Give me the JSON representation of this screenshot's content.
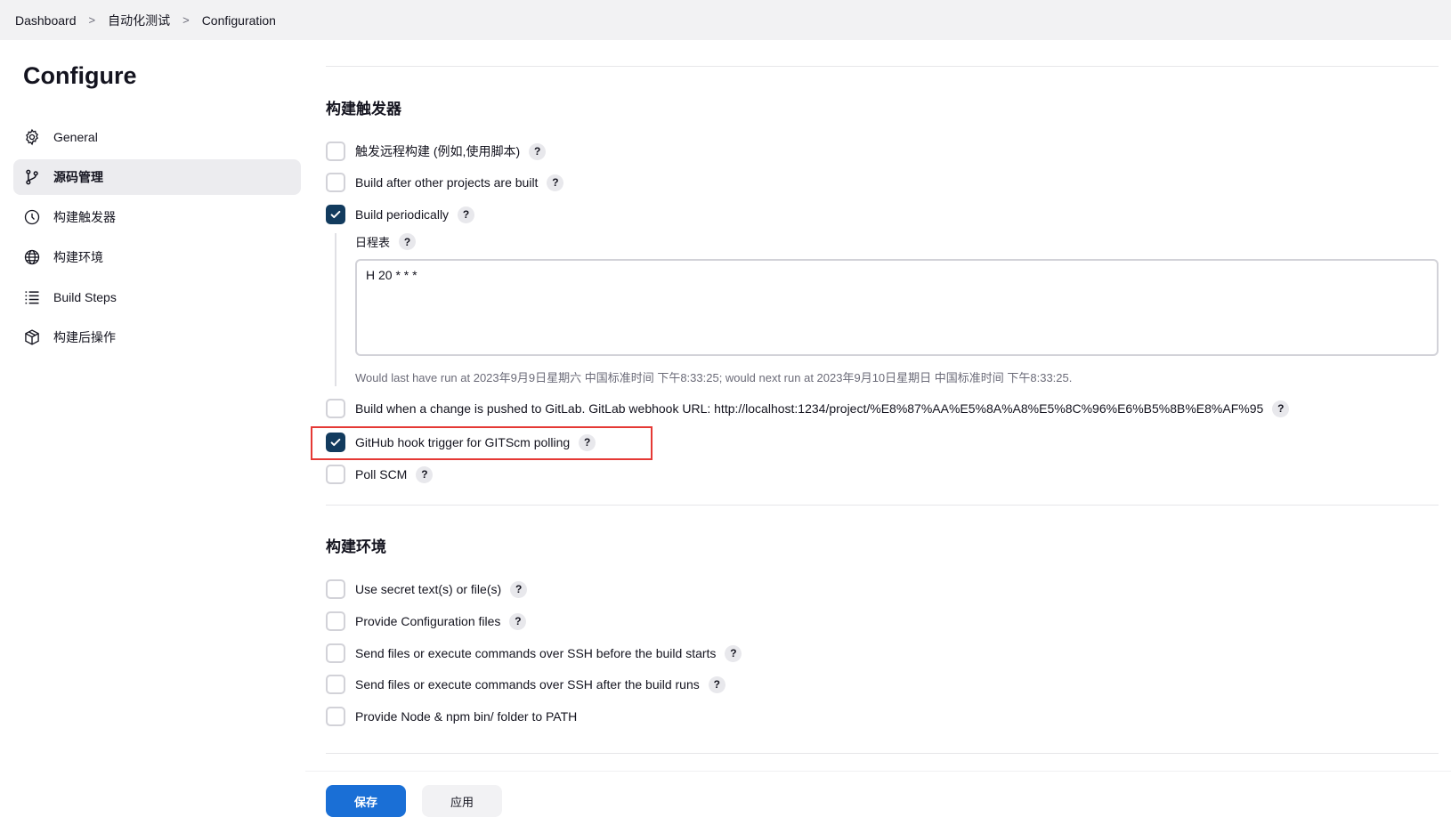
{
  "breadcrumb": [
    "Dashboard",
    "自动化测试",
    "Configuration"
  ],
  "page_title": "Configure",
  "sidebar": {
    "items": [
      {
        "label": "General",
        "icon": "gear-icon"
      },
      {
        "label": "源码管理",
        "icon": "branch-icon"
      },
      {
        "label": "构建触发器",
        "icon": "clock-icon"
      },
      {
        "label": "构建环境",
        "icon": "globe-icon"
      },
      {
        "label": "Build Steps",
        "icon": "list-icon"
      },
      {
        "label": "构建后操作",
        "icon": "package-icon"
      }
    ],
    "active_index": 1
  },
  "triggers": {
    "title": "构建触发器",
    "options": [
      {
        "label": "触发远程构建 (例如,使用脚本)",
        "checked": false
      },
      {
        "label": "Build after other projects are built",
        "checked": false
      },
      {
        "label": "Build periodically",
        "checked": true
      },
      {
        "label": "Build when a change is pushed to GitLab. GitLab webhook URL: http://localhost:1234/project/%E8%87%AA%E5%8A%A8%E5%8C%96%E6%B5%8B%E8%AF%95",
        "checked": false
      },
      {
        "label": "GitHub hook trigger for GITScm polling",
        "checked": true
      },
      {
        "label": "Poll SCM",
        "checked": false
      }
    ],
    "schedule": {
      "label": "日程表",
      "value": "H 20 * * *",
      "info": "Would last have run at 2023年9月9日星期六 中国标准时间 下午8:33:25; would next run at 2023年9月10日星期日 中国标准时间 下午8:33:25."
    }
  },
  "environment": {
    "title": "构建环境",
    "options": [
      {
        "label": "Use secret text(s) or file(s)",
        "checked": false,
        "help": true
      },
      {
        "label": "Provide Configuration files",
        "checked": false,
        "help": true
      },
      {
        "label": "Send files or execute commands over SSH before the build starts",
        "checked": false,
        "help": true
      },
      {
        "label": "Send files or execute commands over SSH after the build runs",
        "checked": false,
        "help": true
      },
      {
        "label": "Provide Node & npm bin/ folder to PATH",
        "checked": false,
        "help": false
      }
    ]
  },
  "help_symbol": "?",
  "buttons": {
    "save": "保存",
    "apply": "应用"
  },
  "colors": {
    "accent": "#1a6fd6",
    "checkbox_checked": "#123b5e",
    "highlight": "#e53935"
  }
}
